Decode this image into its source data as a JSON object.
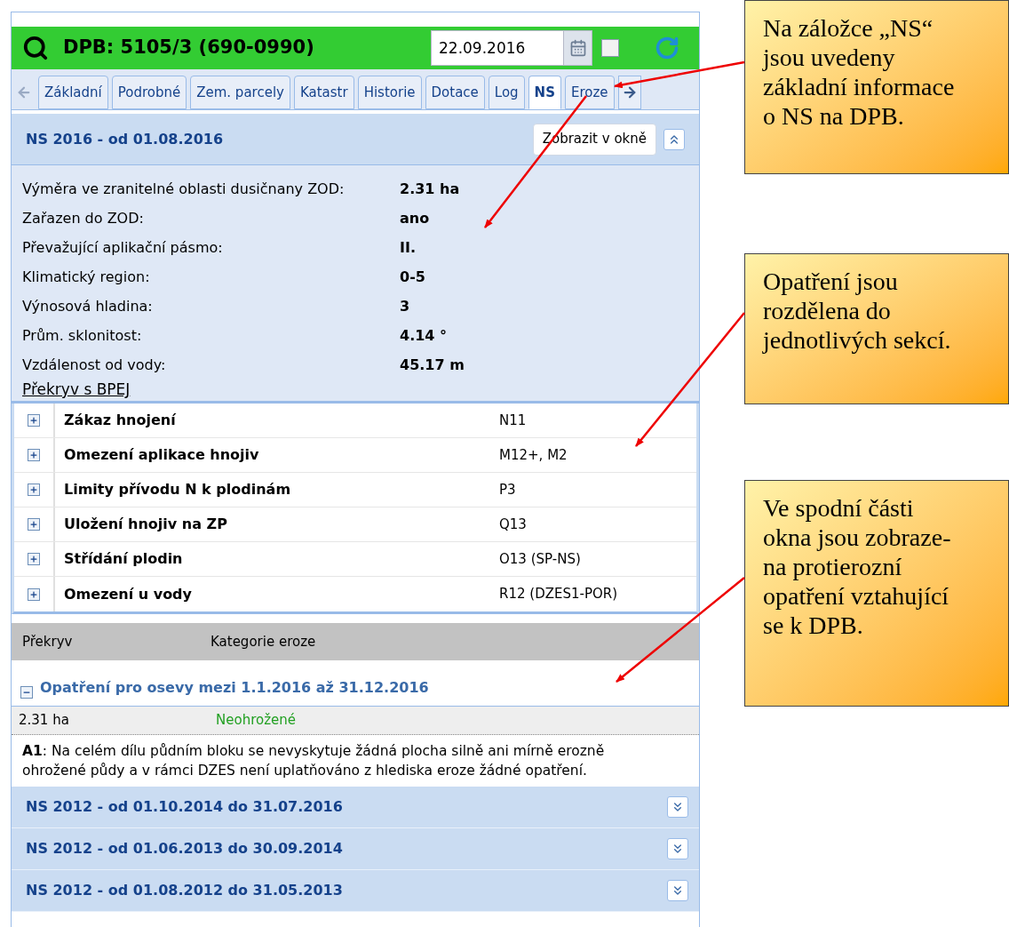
{
  "header": {
    "title": "DPB: 5105/3 (690-0990)",
    "date": "22.09.2016",
    "checked": false
  },
  "tabs": [
    {
      "label": "Základní",
      "selected": false
    },
    {
      "label": "Podrobné",
      "selected": false
    },
    {
      "label": "Zem. parcely",
      "selected": false
    },
    {
      "label": "Katastr",
      "selected": false
    },
    {
      "label": "Historie",
      "selected": false
    },
    {
      "label": "Dotace",
      "selected": false
    },
    {
      "label": "Log",
      "selected": false
    },
    {
      "label": "NS",
      "selected": true
    },
    {
      "label": "Eroze",
      "selected": false
    }
  ],
  "current_section": {
    "title": "NS 2016 - od 01.08.2016",
    "button": "Zobrazit v okně",
    "expanded": true
  },
  "info": [
    {
      "label": "Výměra ve zranitelné oblasti dusičnany ZOD:",
      "value": "2.31 ha"
    },
    {
      "label": "Zařazen do ZOD:",
      "value": "ano"
    },
    {
      "label": "Převažující aplikační pásmo:",
      "value": "II."
    },
    {
      "label": "Klimatický region:",
      "value": "0-5"
    },
    {
      "label": "Výnosová hladina:",
      "value": "3"
    },
    {
      "label": "Prům. sklonitost:",
      "value": "4.14 °"
    },
    {
      "label": "Vzdálenost od vody:",
      "value": "45.17 m"
    }
  ],
  "overlap_link": "Překryv s BPEJ",
  "measures": [
    {
      "name": "Zákaz hnojení",
      "code": "N11",
      "expanded": false
    },
    {
      "name": "Omezení aplikace hnojiv",
      "code": "M12+, M2",
      "expanded": false
    },
    {
      "name": "Limity přívodu N k plodinám",
      "code": "P3",
      "expanded": false
    },
    {
      "name": "Uložení hnojiv na ZP",
      "code": "Q13",
      "expanded": false
    },
    {
      "name": "Střídání plodin",
      "code": "O13 (SP-NS)",
      "expanded": false
    },
    {
      "name": "Omezení u vody",
      "code": "R12 (DZES1-POR)",
      "expanded": false
    }
  ],
  "erosion": {
    "columns": [
      "Překryv",
      "Kategorie eroze"
    ],
    "group": {
      "title": "Opatření pro osevy mezi 1.1.2016 až 31.12.2016",
      "expanded": true
    },
    "row": {
      "area": "2.31 ha",
      "category": "Neohrožené"
    },
    "note": "**A1**: Na celém dílu půdním bloku se nevyskytuje žádná plocha silně ani mírně erozně ohrožené půdy a v rámci DZES není uplatňováno z hlediska eroze žádné opatření."
  },
  "other_sections": [
    {
      "title": "NS 2012 - od 01.10.2014 do 31.07.2016",
      "expanded": false
    },
    {
      "title": "NS 2012 - od 01.06.2013 do 30.09.2014",
      "expanded": false
    },
    {
      "title": "NS 2012 - od 01.08.2012 do 31.05.2013",
      "expanded": false
    }
  ],
  "callouts": [
    "Na záložce „NS“\njsou uvedeny\nzákladní informace\no NS na DPB.",
    "Opatření jsou\nrozdělena do\njednotlivých sekcí.",
    "Ve spodní části\nokna jsou zobraze-\nna protierozní\nopatření vztahující\nse k DPB."
  ]
}
